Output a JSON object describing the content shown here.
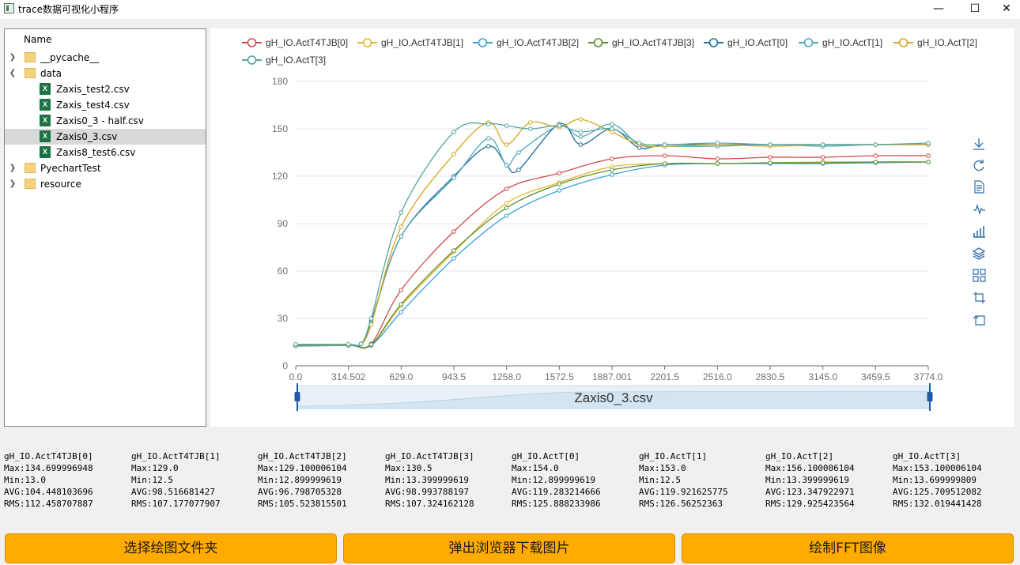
{
  "window": {
    "title": "trace数据可视化小程序",
    "minimize_glyph": "—",
    "maximize_glyph": "☐",
    "close_glyph": "✕"
  },
  "tree": {
    "header": "Name",
    "items": [
      {
        "label": "__pycache__",
        "kind": "folder",
        "expanded": false,
        "level": 0
      },
      {
        "label": "data",
        "kind": "folder",
        "expanded": true,
        "level": 0
      },
      {
        "label": "Zaxis_test2.csv",
        "kind": "csv",
        "level": 1
      },
      {
        "label": "Zaxis_test4.csv",
        "kind": "csv",
        "level": 1
      },
      {
        "label": "Zaxis0_3 - half.csv",
        "kind": "csv",
        "level": 1
      },
      {
        "label": "Zaxis0_3.csv",
        "kind": "csv",
        "level": 1,
        "selected": true
      },
      {
        "label": "Zaxis8_test6.csv",
        "kind": "csv",
        "level": 1
      },
      {
        "label": "PyechartTest",
        "kind": "folder",
        "expanded": false,
        "level": 0
      },
      {
        "label": "resource",
        "kind": "folder",
        "expanded": false,
        "level": 0
      }
    ]
  },
  "chart_data": {
    "type": "line",
    "title": "",
    "xlabel": "",
    "ylabel": "",
    "x_tick_labels": [
      "0.0",
      "314.502",
      "629.0",
      "943.5",
      "1258.0",
      "1572.5",
      "1887.001",
      "2201.5",
      "2516.0",
      "2830.5",
      "3145.0",
      "3459.5",
      "3774.0"
    ],
    "xlim": [
      0,
      3774
    ],
    "ylim": [
      0,
      180
    ],
    "y_ticks": [
      0,
      30,
      60,
      90,
      120,
      150,
      180
    ],
    "grid": "horizontal",
    "legend_position": "top",
    "datazoom_label": "Zaxis0_3.csv",
    "series": [
      {
        "name": "gH_IO.ActT4TJB[0]",
        "color": "#d14a4a",
        "x": [
          0,
          314.5,
          450,
          629,
          943.5,
          1258,
          1572.5,
          1887,
          2201.5,
          2516,
          2830.5,
          3145,
          3459.5,
          3774
        ],
        "y": [
          13,
          13,
          14,
          48,
          85,
          112,
          122,
          131,
          133,
          131,
          132,
          132,
          133,
          133
        ]
      },
      {
        "name": "gH_IO.ActT4TJB[1]",
        "color": "#e5b62b",
        "x": [
          0,
          314.5,
          450,
          629,
          943.5,
          1258,
          1572.5,
          1887,
          2201.5,
          2516,
          2830.5,
          3145,
          3459.5,
          3774
        ],
        "y": [
          12.5,
          13,
          13,
          38,
          72,
          103,
          116,
          126,
          128,
          128,
          128.5,
          129,
          129,
          129
        ]
      },
      {
        "name": "gH_IO.ActT4TJB[2]",
        "color": "#3ca4d4",
        "x": [
          0,
          314.5,
          450,
          629,
          943.5,
          1258,
          1572.5,
          1887,
          2201.5,
          2516,
          2830.5,
          3145,
          3459.5,
          3774
        ],
        "y": [
          13,
          13,
          13,
          34,
          68,
          95,
          111,
          121,
          127,
          128,
          128,
          128,
          128.5,
          129
        ]
      },
      {
        "name": "gH_IO.ActT4TJB[3]",
        "color": "#5b8f2e",
        "x": [
          0,
          314.5,
          450,
          629,
          943.5,
          1258,
          1572.5,
          1887,
          2201.5,
          2516,
          2830.5,
          3145,
          3459.5,
          3774
        ],
        "y": [
          13.4,
          13.4,
          13.5,
          39,
          73,
          100,
          115,
          124,
          128,
          128,
          128.5,
          128.5,
          129,
          129
        ]
      },
      {
        "name": "gH_IO.ActT[0]",
        "color": "#1f6d99",
        "x": [
          0,
          314.5,
          390,
          450,
          629,
          943.5,
          1150,
          1258,
          1330,
          1572.5,
          1700,
          1887,
          2050,
          2201.5,
          2516,
          2830.5,
          3145,
          3459.5,
          3774
        ],
        "y": [
          13,
          13,
          14,
          28,
          82,
          120,
          139,
          127,
          124,
          153,
          140,
          150,
          138,
          140,
          140,
          140,
          140,
          140,
          140
        ]
      },
      {
        "name": "gH_IO.ActT[1]",
        "color": "#4ea6b8",
        "x": [
          0,
          314.5,
          390,
          450,
          629,
          943.5,
          1150,
          1258,
          1330,
          1572.5,
          1700,
          1887,
          2050,
          2201.5,
          2516,
          2830.5,
          3145,
          3459.5,
          3774
        ],
        "y": [
          12.5,
          13,
          14,
          27,
          82,
          119,
          144,
          127,
          135,
          152,
          145,
          153,
          140,
          139,
          139,
          140,
          139,
          140,
          140
        ]
      },
      {
        "name": "gH_IO.ActT[2]",
        "color": "#d9a51c",
        "x": [
          0,
          314.5,
          390,
          450,
          629,
          943.5,
          1150,
          1258,
          1400,
          1572.5,
          1700,
          1887,
          2050,
          2201.5,
          2516,
          2830.5,
          3145,
          3459.5,
          3774
        ],
        "y": [
          13.4,
          13.4,
          14,
          26,
          88,
          134,
          154,
          140,
          154,
          151,
          156,
          148,
          140,
          139,
          140,
          139,
          140,
          140,
          140
        ]
      },
      {
        "name": "gH_IO.ActT[3]",
        "color": "#56a6a0",
        "x": [
          0,
          314.5,
          390,
          450,
          629,
          943.5,
          1150,
          1258,
          1400,
          1572.5,
          1700,
          1887,
          2050,
          2201.5,
          2516,
          2830.5,
          3145,
          3459.5,
          3774
        ],
        "y": [
          13.7,
          13.7,
          14,
          30,
          97,
          148,
          153,
          152,
          150,
          152,
          148,
          150,
          141,
          140,
          141,
          140,
          140,
          140,
          141
        ]
      }
    ]
  },
  "toolbox": {
    "icons": [
      "download-icon",
      "refresh-icon",
      "data-view-icon",
      "line-chart-icon",
      "bar-chart-icon",
      "stack-icon",
      "tiled-icon",
      "zoom-icon",
      "zoom-reset-icon"
    ]
  },
  "stats": [
    {
      "name": "gH_IO.ActT4TJB[0]",
      "max": "Max:134.699996948",
      "min": "Min:13.0",
      "avg": "AVG:104.448103696",
      "rms": "RMS:112.458707887"
    },
    {
      "name": "gH_IO.ActT4TJB[1]",
      "max": "Max:129.0",
      "min": "Min:12.5",
      "avg": "AVG:98.516681427",
      "rms": "RMS:107.177077907"
    },
    {
      "name": "gH_IO.ActT4TJB[2]",
      "max": "Max:129.100006104",
      "min": "Min:12.899999619",
      "avg": "AVG:96.798705328",
      "rms": "RMS:105.523815501"
    },
    {
      "name": "gH_IO.ActT4TJB[3]",
      "max": "Max:130.5",
      "min": "Min:13.399999619",
      "avg": "AVG:98.993788197",
      "rms": "RMS:107.324162128"
    },
    {
      "name": "gH_IO.ActT[0]",
      "max": "Max:154.0",
      "min": "Min:12.899999619",
      "avg": "AVG:119.283214666",
      "rms": "RMS:125.888233986"
    },
    {
      "name": "gH_IO.ActT[1]",
      "max": "Max:153.0",
      "min": "Min:12.5",
      "avg": "AVG:119.921625775",
      "rms": "RMS:126.56252363"
    },
    {
      "name": "gH_IO.ActT[2]",
      "max": "Max:156.100006104",
      "min": "Min:13.399999619",
      "avg": "AVG:123.347922971",
      "rms": "RMS:129.925423564"
    },
    {
      "name": "gH_IO.ActT[3]",
      "max": "Max:153.100006104",
      "min": "Min:13.699999809",
      "avg": "AVG:125.709512082",
      "rms": "RMS:132.019441428"
    }
  ],
  "buttons": {
    "select_folder": "选择绘图文件夹",
    "browser_download": "弹出浏览器下载图片",
    "draw_fft": "绘制FFT图像"
  }
}
